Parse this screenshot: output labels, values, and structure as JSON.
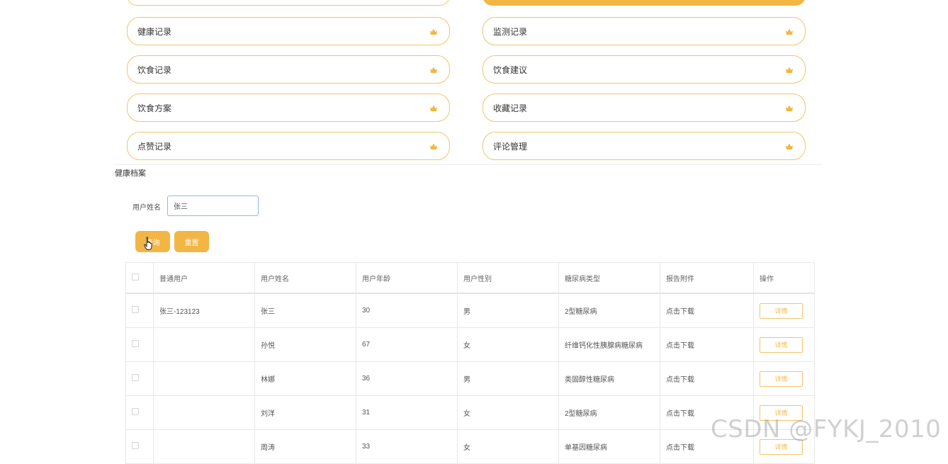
{
  "menu": {
    "items": [
      {
        "label": "健康记录",
        "icon": "crown-icon"
      },
      {
        "label": "监测记录",
        "icon": "crown-icon"
      },
      {
        "label": "饮食记录",
        "icon": "crown-icon"
      },
      {
        "label": "饮食建议",
        "icon": "crown-icon"
      },
      {
        "label": "饮食方案",
        "icon": "crown-icon"
      },
      {
        "label": "收藏记录",
        "icon": "crown-icon"
      },
      {
        "label": "点赞记录",
        "icon": "crown-icon"
      },
      {
        "label": "评论管理",
        "icon": "crown-icon"
      }
    ]
  },
  "section": {
    "title": "健康档案"
  },
  "filter": {
    "label": "用户姓名",
    "value": "张三"
  },
  "buttons": {
    "search": "查询",
    "reset": "重置"
  },
  "table": {
    "headers": [
      "普通用户",
      "用户姓名",
      "用户年龄",
      "用户性别",
      "糖尿病类型",
      "报告附件",
      "操作"
    ],
    "rows": [
      {
        "user": "张三-123123",
        "name": "张三",
        "age": "30",
        "gender": "男",
        "type": "2型糖尿病",
        "attachment": "点击下载",
        "action": "详情"
      },
      {
        "user": "",
        "name": "孙悦",
        "age": "67",
        "gender": "女",
        "type": "纤维钙化性胰腺病糖尿病",
        "attachment": "点击下载",
        "action": "详情"
      },
      {
        "user": "",
        "name": "林娜",
        "age": "36",
        "gender": "男",
        "type": "类固醇性糖尿病",
        "attachment": "点击下载",
        "action": "详情"
      },
      {
        "user": "",
        "name": "刘洋",
        "age": "31",
        "gender": "女",
        "type": "2型糖尿病",
        "attachment": "点击下载",
        "action": "详情"
      },
      {
        "user": "",
        "name": "周涛",
        "age": "33",
        "gender": "女",
        "type": "单基因糖尿病",
        "attachment": "点击下载",
        "action": "详情"
      }
    ]
  },
  "watermark": "CSDN @FYKJ_2010",
  "colors": {
    "accent": "#f3b644",
    "border": "#f2c46a"
  }
}
